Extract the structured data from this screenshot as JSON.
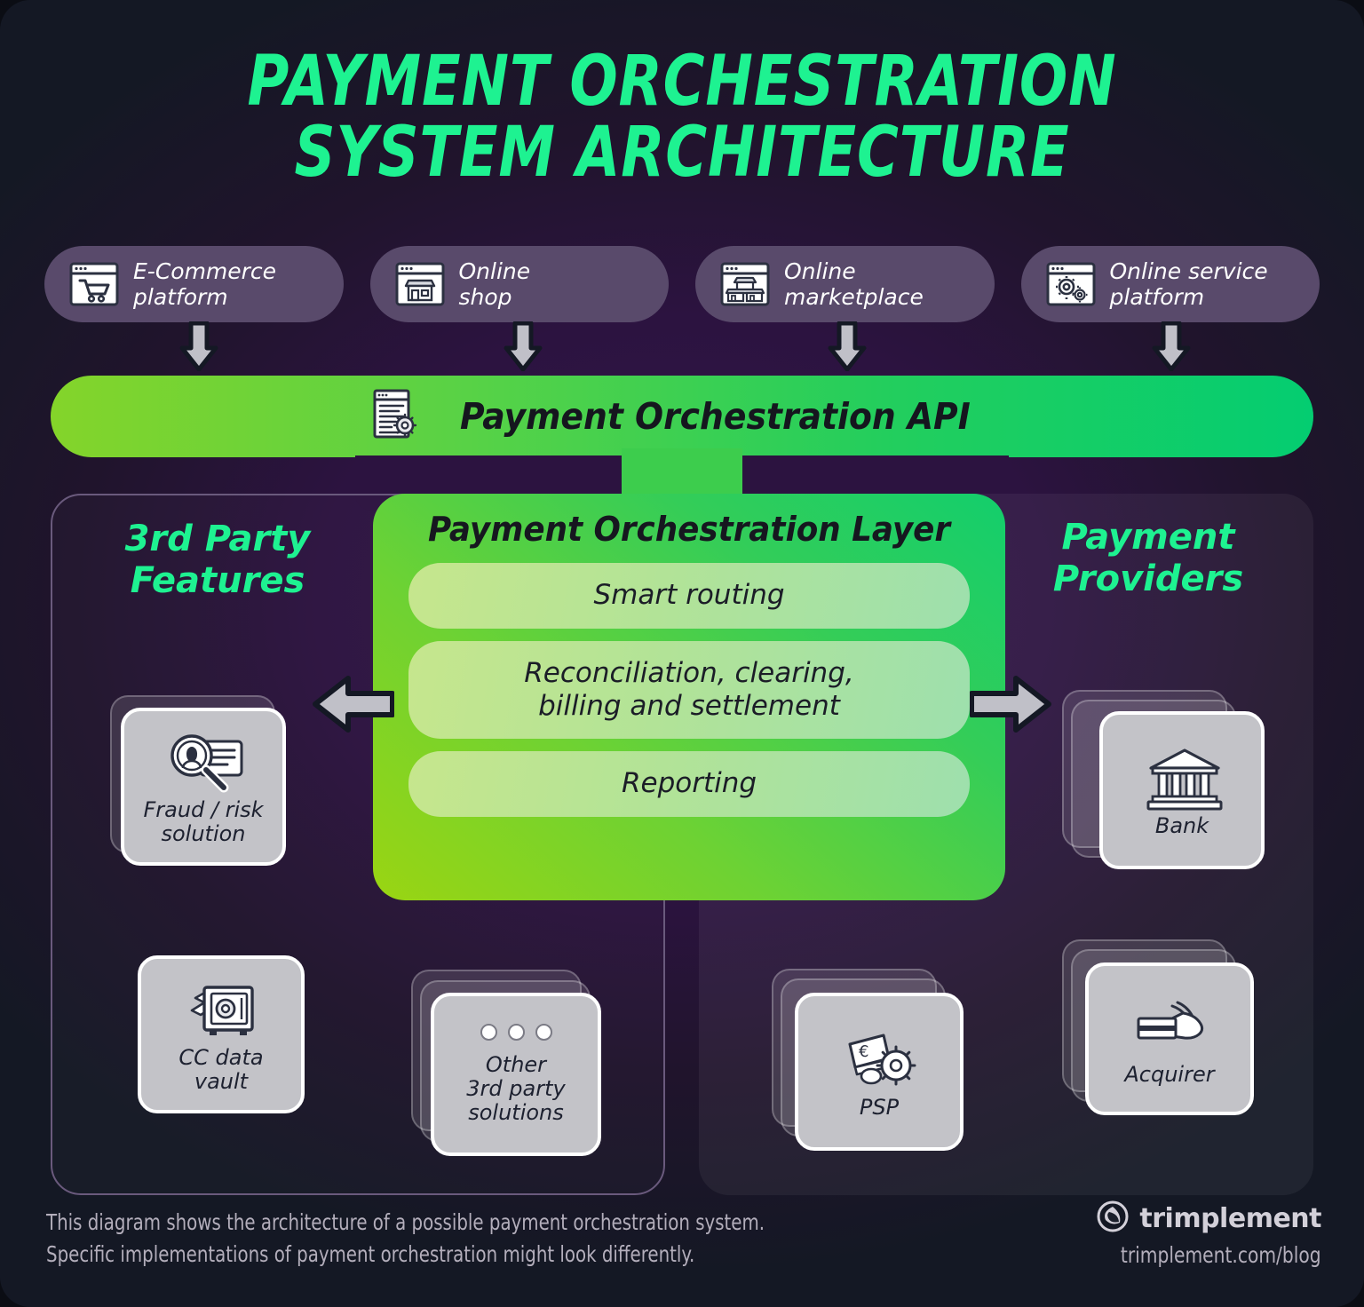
{
  "theme": {
    "bg_dark": "#141824",
    "bg_purple": "#2c1340",
    "accent_green": "#1ef291",
    "api_gradient_start": "#84d42a",
    "api_gradient_end": "#04cd71",
    "card_purple": "#594a6b",
    "tile_gray": "#c3c3c8",
    "arrow_gray": "#c0c0c8",
    "ink": "#16171f"
  },
  "title": {
    "line1": "PAYMENT ORCHESTRATION",
    "line2": "SYSTEM ARCHITECTURE"
  },
  "sources": [
    {
      "label": "E-Commerce\nplatform",
      "icon": "shopping-cart-window-icon"
    },
    {
      "label": "Online\nshop",
      "icon": "storefront-window-icon"
    },
    {
      "label": "Online\nmarketplace",
      "icon": "marketplace-window-icon"
    },
    {
      "label": "Online service\nplatform",
      "icon": "gears-window-icon"
    }
  ],
  "api": {
    "label": "Payment Orchestration API",
    "icon": "document-gear-icon"
  },
  "layer": {
    "title": "Payment Orchestration Layer",
    "features": [
      "Smart routing",
      "Reconciliation, clearing,\nbilling and settlement",
      "Reporting"
    ]
  },
  "left_panel": {
    "heading": "3rd Party\nFeatures",
    "items": [
      {
        "label": "Fraud / risk\nsolution",
        "icon": "magnifier-id-card-icon",
        "stack": 1
      },
      {
        "label": "CC data\nvault",
        "icon": "safe-vault-icon",
        "stack": 0
      },
      {
        "label": "Other\n3rd party\nsolutions",
        "icon": "three-dots-icon",
        "stack": 2
      }
    ]
  },
  "right_panel": {
    "heading": "Payment\nProviders",
    "items": [
      {
        "label": "Bank",
        "icon": "bank-building-icon",
        "stack": 2
      },
      {
        "label": "PSP",
        "icon": "euro-note-gear-icon",
        "stack": 2
      },
      {
        "label": "Acquirer",
        "icon": "hand-credit-card-icon",
        "stack": 2
      }
    ]
  },
  "footer": {
    "note": "This diagram shows the architecture of a possible payment orchestration system.\nSpecific implementations of payment orchestration might look differently.",
    "brand_name": "trimplement",
    "brand_url": "trimplement.com/blog",
    "brand_icon": "trimplement-droplet-logo"
  }
}
